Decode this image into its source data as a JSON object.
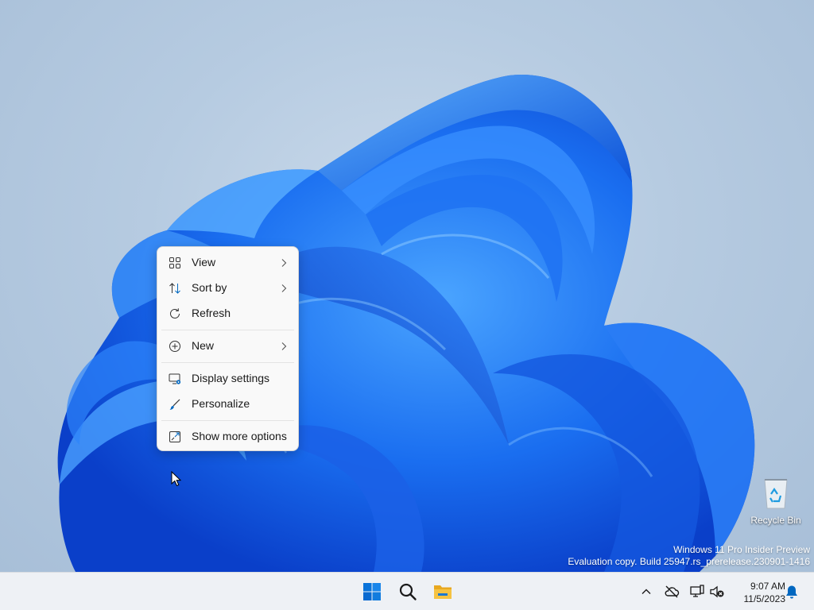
{
  "context_menu": {
    "items": [
      {
        "label": "View",
        "icon": "view-grid-icon",
        "has_submenu": true
      },
      {
        "label": "Sort by",
        "icon": "sort-icon",
        "has_submenu": true
      },
      {
        "label": "Refresh",
        "icon": "refresh-icon",
        "has_submenu": false
      },
      {
        "label": "New",
        "icon": "new-plus-icon",
        "has_submenu": true
      },
      {
        "label": "Display settings",
        "icon": "display-settings-icon",
        "has_submenu": false
      },
      {
        "label": "Personalize",
        "icon": "brush-icon",
        "has_submenu": false
      },
      {
        "label": "Show more options",
        "icon": "show-more-options-icon",
        "has_submenu": false
      }
    ]
  },
  "desktop": {
    "recycle_bin_label": "Recycle Bin",
    "watermark": {
      "line1": "Windows 11 Pro Insider Preview",
      "line2": "Evaluation copy. Build 25947.rs_prerelease.230901-1416"
    }
  },
  "taskbar": {
    "apps": [
      {
        "name": "start",
        "icon": "windows-logo-icon"
      },
      {
        "name": "search",
        "icon": "search-icon"
      },
      {
        "name": "file-explorer",
        "icon": "folder-icon"
      }
    ],
    "tray": {
      "icons": [
        "chevron-up-icon",
        "cloud-offline-icon",
        "network-icon",
        "speaker-muted-icon",
        "notification-bell-icon"
      ]
    },
    "clock": {
      "time": "9:07 AM",
      "date": "11/5/2023"
    }
  },
  "colors": {
    "accent": "#0067c0",
    "bloom_dark": "#0a3fc9",
    "bloom_mid": "#1a6ef0",
    "bloom_light": "#4aa4ff",
    "folder_yellow": "#f5c342"
  }
}
